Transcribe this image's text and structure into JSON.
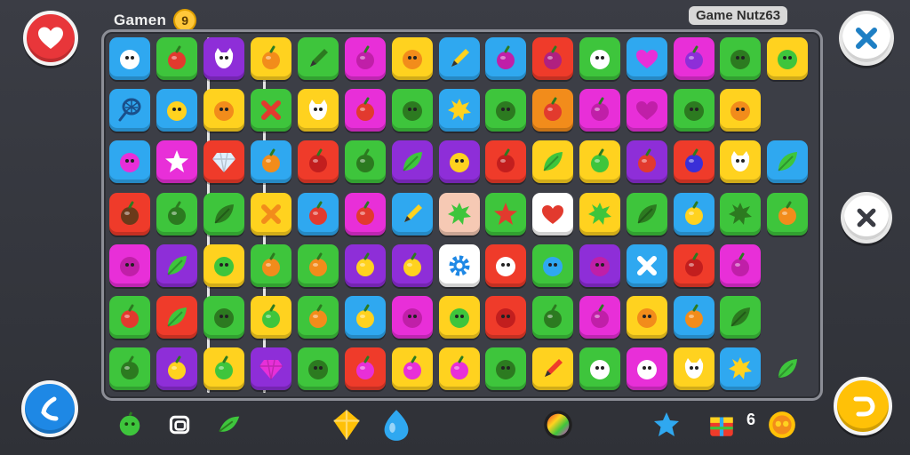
{
  "header": {
    "title": "Gamen",
    "coin_label": "9",
    "brand": "Game Nutz63"
  },
  "buttons": {
    "heart": "heart-icon",
    "call": "phone-icon",
    "close_top": "close-icon",
    "close_mid": "close-icon",
    "undo": "undo-icon"
  },
  "board": {
    "columns": 15,
    "rows": [
      [
        {
          "bg": "#2fa8f0",
          "icon": "face",
          "fg": "#ffffff"
        },
        {
          "bg": "#3ec53c",
          "icon": "fruit",
          "fg": "#e23a2e"
        },
        {
          "bg": "#8e2ed8",
          "icon": "cat",
          "fg": "#ffffff"
        },
        {
          "bg": "#ffd21f",
          "icon": "fruit",
          "fg": "#f28c1b"
        },
        {
          "bg": "#3ec53c",
          "icon": "pencil",
          "fg": "#2c7a20"
        },
        {
          "bg": "#e82fd8",
          "icon": "fruit",
          "fg": "#c01fa8"
        },
        {
          "bg": "#ffd21f",
          "icon": "face",
          "fg": "#f28c1b"
        },
        {
          "bg": "#2fa8f0",
          "icon": "pencil",
          "fg": "#ffd21f"
        },
        {
          "bg": "#2fa8f0",
          "icon": "fruit",
          "fg": "#c01fa8"
        },
        {
          "bg": "#ef3b2a",
          "icon": "fruit",
          "fg": "#b02080"
        },
        {
          "bg": "#3ec53c",
          "icon": "face",
          "fg": "#ffffff"
        },
        {
          "bg": "#2fa8f0",
          "icon": "heart",
          "fg": "#e82fd8"
        },
        {
          "bg": "#e82fd8",
          "icon": "fruit",
          "fg": "#8e2ed8"
        },
        {
          "bg": "#3ec53c",
          "icon": "face",
          "fg": "#2c7a20"
        },
        {
          "bg": "#ffd21f",
          "icon": "face",
          "fg": "#3ec53c"
        }
      ],
      [
        {
          "bg": "#2fa8f0",
          "icon": "net",
          "fg": "#1a4f8a"
        },
        {
          "bg": "#2fa8f0",
          "icon": "face",
          "fg": "#ffd21f"
        },
        {
          "bg": "#ffd21f",
          "icon": "face",
          "fg": "#f28c1b"
        },
        {
          "bg": "#3ec53c",
          "icon": "cross",
          "fg": "#e23a2e"
        },
        {
          "bg": "#ffd21f",
          "icon": "cat",
          "fg": "#ffffff"
        },
        {
          "bg": "#e82fd8",
          "icon": "fruit",
          "fg": "#e23a2e"
        },
        {
          "bg": "#3ec53c",
          "icon": "face",
          "fg": "#2c7a20"
        },
        {
          "bg": "#2fa8f0",
          "icon": "splat",
          "fg": "#ffd21f"
        },
        {
          "bg": "#3ec53c",
          "icon": "face",
          "fg": "#2c7a20"
        },
        {
          "bg": "#f28c1b",
          "icon": "fruit",
          "fg": "#e23a2e"
        },
        {
          "bg": "#e82fd8",
          "icon": "fruit",
          "fg": "#c01fa8"
        },
        {
          "bg": "#e82fd8",
          "icon": "heart",
          "fg": "#c01fa8"
        },
        {
          "bg": "#3ec53c",
          "icon": "face",
          "fg": "#2c7a20"
        },
        {
          "bg": "#ffd21f",
          "icon": "face",
          "fg": "#f28c1b"
        },
        null
      ],
      [
        {
          "bg": "#2fa8f0",
          "icon": "face",
          "fg": "#e82fd8"
        },
        {
          "bg": "#e82fd8",
          "icon": "star",
          "fg": "#ffffff"
        },
        {
          "bg": "#ef3b2a",
          "icon": "gem",
          "fg": "#dfefff"
        },
        {
          "bg": "#2fa8f0",
          "icon": "fruit",
          "fg": "#f28c1b"
        },
        {
          "bg": "#ef3b2a",
          "icon": "fruit",
          "fg": "#c21e1e"
        },
        {
          "bg": "#3ec53c",
          "icon": "fruit",
          "fg": "#2c7a20"
        },
        {
          "bg": "#8e2ed8",
          "icon": "leaf",
          "fg": "#3ec53c"
        },
        {
          "bg": "#8e2ed8",
          "icon": "face",
          "fg": "#ffd21f"
        },
        {
          "bg": "#ef3b2a",
          "icon": "fruit",
          "fg": "#c21e1e"
        },
        {
          "bg": "#ffd21f",
          "icon": "leaf",
          "fg": "#3ec53c"
        },
        {
          "bg": "#ffd21f",
          "icon": "fruit",
          "fg": "#3ec53c"
        },
        {
          "bg": "#8e2ed8",
          "icon": "fruit",
          "fg": "#e23a2e"
        },
        {
          "bg": "#ef3b2a",
          "icon": "fruit",
          "fg": "#3a2fd8"
        },
        {
          "bg": "#ffd21f",
          "icon": "cat",
          "fg": "#ffffff"
        },
        {
          "bg": "#2fa8f0",
          "icon": "leaf",
          "fg": "#3ec53c"
        }
      ],
      [
        {
          "bg": "#ef3b2a",
          "icon": "fruit",
          "fg": "#6b3a1a"
        },
        {
          "bg": "#3ec53c",
          "icon": "fruit",
          "fg": "#2c7a20"
        },
        {
          "bg": "#3ec53c",
          "icon": "leaf",
          "fg": "#2c7a20"
        },
        {
          "bg": "#ffd21f",
          "icon": "cross",
          "fg": "#f28c1b"
        },
        {
          "bg": "#2fa8f0",
          "icon": "fruit",
          "fg": "#e23a2e"
        },
        {
          "bg": "#e82fd8",
          "icon": "fruit",
          "fg": "#e23a2e"
        },
        {
          "bg": "#2fa8f0",
          "icon": "pencil",
          "fg": "#ffd21f"
        },
        {
          "bg": "#f6c9b4",
          "icon": "splat",
          "fg": "#3ec53c"
        },
        {
          "bg": "#3ec53c",
          "icon": "star",
          "fg": "#e23a2e"
        },
        {
          "bg": "#ffffff",
          "icon": "heart",
          "fg": "#e23a2e"
        },
        {
          "bg": "#ffd21f",
          "icon": "splat",
          "fg": "#3ec53c"
        },
        {
          "bg": "#3ec53c",
          "icon": "leaf",
          "fg": "#2c7a20"
        },
        {
          "bg": "#2fa8f0",
          "icon": "fruit",
          "fg": "#ffd21f"
        },
        {
          "bg": "#3ec53c",
          "icon": "splat",
          "fg": "#2c7a20"
        },
        {
          "bg": "#3ec53c",
          "icon": "fruit",
          "fg": "#f28c1b"
        }
      ],
      [
        {
          "bg": "#e82fd8",
          "icon": "face",
          "fg": "#c01fa8"
        },
        {
          "bg": "#8e2ed8",
          "icon": "leaf",
          "fg": "#3ec53c"
        },
        {
          "bg": "#ffd21f",
          "icon": "face",
          "fg": "#3ec53c"
        },
        {
          "bg": "#3ec53c",
          "icon": "fruit",
          "fg": "#f28c1b"
        },
        {
          "bg": "#3ec53c",
          "icon": "fruit",
          "fg": "#f28c1b"
        },
        {
          "bg": "#8e2ed8",
          "icon": "fruit",
          "fg": "#ffd21f"
        },
        {
          "bg": "#8e2ed8",
          "icon": "fruit",
          "fg": "#ffd21f"
        },
        {
          "bg": "#ffffff",
          "icon": "gear",
          "fg": "#1e88e5"
        },
        {
          "bg": "#ef3b2a",
          "icon": "face",
          "fg": "#ffffff"
        },
        {
          "bg": "#3ec53c",
          "icon": "face",
          "fg": "#2fa8f0"
        },
        {
          "bg": "#8e2ed8",
          "icon": "face",
          "fg": "#c01fa8"
        },
        {
          "bg": "#2fa8f0",
          "icon": "cross",
          "fg": "#ffffff"
        },
        {
          "bg": "#ef3b2a",
          "icon": "fruit",
          "fg": "#c21e1e"
        },
        {
          "bg": "#e82fd8",
          "icon": "fruit",
          "fg": "#c01fa8"
        },
        null
      ],
      [
        {
          "bg": "#3ec53c",
          "icon": "fruit",
          "fg": "#e23a2e"
        },
        {
          "bg": "#ef3b2a",
          "icon": "leaf",
          "fg": "#3ec53c"
        },
        {
          "bg": "#3ec53c",
          "icon": "face",
          "fg": "#2c7a20"
        },
        {
          "bg": "#ffd21f",
          "icon": "fruit",
          "fg": "#3ec53c"
        },
        {
          "bg": "#3ec53c",
          "icon": "fruit",
          "fg": "#f28c1b"
        },
        {
          "bg": "#2fa8f0",
          "icon": "fruit",
          "fg": "#ffd21f"
        },
        {
          "bg": "#e82fd8",
          "icon": "face",
          "fg": "#c01fa8"
        },
        {
          "bg": "#ffd21f",
          "icon": "face",
          "fg": "#3ec53c"
        },
        {
          "bg": "#ef3b2a",
          "icon": "face",
          "fg": "#c21e1e"
        },
        {
          "bg": "#3ec53c",
          "icon": "fruit",
          "fg": "#2c7a20"
        },
        {
          "bg": "#e82fd8",
          "icon": "fruit",
          "fg": "#c01fa8"
        },
        {
          "bg": "#ffd21f",
          "icon": "face",
          "fg": "#f28c1b"
        },
        {
          "bg": "#2fa8f0",
          "icon": "fruit",
          "fg": "#f28c1b"
        },
        {
          "bg": "#3ec53c",
          "icon": "leaf",
          "fg": "#2c7a20"
        },
        null
      ],
      [
        {
          "bg": "#3ec53c",
          "icon": "fruit",
          "fg": "#2c7a20"
        },
        {
          "bg": "#8e2ed8",
          "icon": "fruit",
          "fg": "#ffd21f"
        },
        {
          "bg": "#ffd21f",
          "icon": "fruit",
          "fg": "#3ec53c"
        },
        {
          "bg": "#8e2ed8",
          "icon": "gem",
          "fg": "#e82fd8"
        },
        {
          "bg": "#3ec53c",
          "icon": "face",
          "fg": "#2c7a20"
        },
        {
          "bg": "#ef3b2a",
          "icon": "fruit",
          "fg": "#e82fd8"
        },
        {
          "bg": "#ffd21f",
          "icon": "fruit",
          "fg": "#e82fd8"
        },
        {
          "bg": "#ffd21f",
          "icon": "fruit",
          "fg": "#e82fd8"
        },
        {
          "bg": "#3ec53c",
          "icon": "face",
          "fg": "#2c7a20"
        },
        {
          "bg": "#ffd21f",
          "icon": "pencil",
          "fg": "#ef3b2a"
        },
        {
          "bg": "#3ec53c",
          "icon": "face",
          "fg": "#ffffff"
        },
        {
          "bg": "#e82fd8",
          "icon": "face",
          "fg": "#ffffff"
        },
        {
          "bg": "#ffd21f",
          "icon": "cat",
          "fg": "#ffffff"
        },
        {
          "bg": "#2fa8f0",
          "icon": "splat",
          "fg": "#ffd21f"
        },
        {
          "bg": "none",
          "icon": "leaf",
          "fg": "#3ec53c"
        }
      ]
    ]
  },
  "bottom_bar": {
    "items": [
      {
        "name": "green-face-icon",
        "color": "#3ec53c"
      },
      {
        "name": "camera-icon",
        "color": "#ffffff"
      },
      {
        "name": "leaf-icon",
        "color": "#3ec53c"
      },
      {
        "name": "yellow-gem-icon",
        "color": "#ffc107"
      },
      {
        "name": "blue-orb-icon",
        "color": "#2fa8f0"
      },
      {
        "name": "rainbow-orb-icon",
        "color": "#e82fd8"
      },
      {
        "name": "star-icon",
        "color": "#2fa8f0"
      },
      {
        "name": "gift-box-icon",
        "color": "#ef3b2a"
      },
      {
        "name": "coin-icon",
        "color": "#ffc107"
      }
    ],
    "count": "6"
  }
}
